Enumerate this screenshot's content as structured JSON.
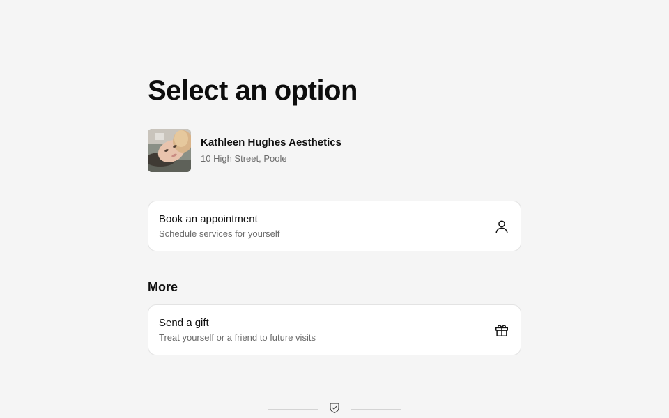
{
  "page": {
    "title": "Select an option"
  },
  "venue": {
    "name": "Kathleen Hughes Aesthetics",
    "address": "10 High Street, Poole"
  },
  "options": {
    "book": {
      "title": "Book an appointment",
      "subtitle": "Schedule services for yourself",
      "icon": "user-icon"
    }
  },
  "more": {
    "heading": "More",
    "gift": {
      "title": "Send a gift",
      "subtitle": "Treat yourself or a friend to future visits",
      "icon": "gift-icon"
    }
  },
  "footer": {
    "icon": "shield-check-icon"
  },
  "colors": {
    "background": "#f5f5f5",
    "card": "#ffffff",
    "card_border": "#e3e3e3",
    "text_primary": "#101010",
    "text_secondary": "#6b6b6b"
  }
}
